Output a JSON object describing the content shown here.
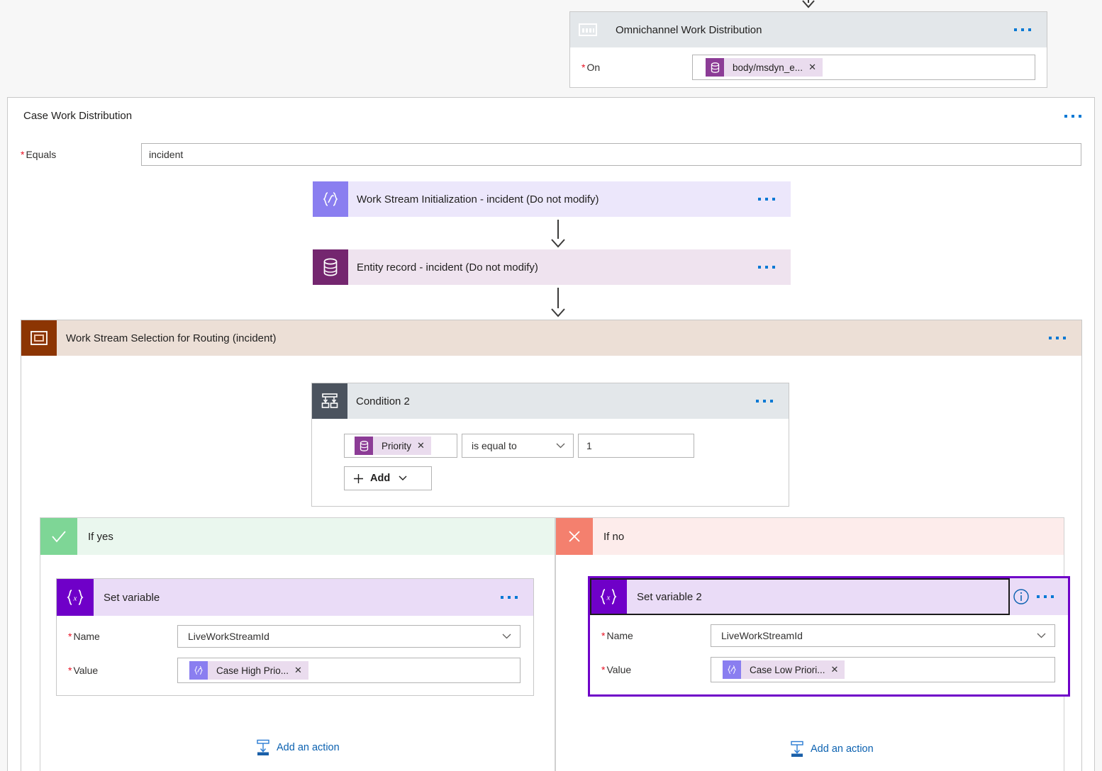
{
  "trigger": {
    "title": "Omnichannel Work Distribution",
    "icon": "keyboard-icon",
    "menu": "more-options",
    "field": {
      "label": "On",
      "required": true,
      "token": "body/msdyn_e...",
      "token_icon": "database-icon"
    }
  },
  "surface": {
    "title": "Case Work Distribution",
    "menu": "more-options",
    "equals": {
      "label": "Equals",
      "required": true,
      "value": "incident"
    }
  },
  "cards": {
    "work_stream_init": {
      "title": "Work Stream Initialization - incident (Do not modify)",
      "icon": "expression-icon"
    },
    "entity_record": {
      "title": "Entity record - incident (Do not modify)",
      "icon": "database-icon"
    }
  },
  "scope": {
    "title": "Work Stream Selection for Routing (incident)",
    "icon": "scope-icon"
  },
  "condition": {
    "title": "Condition 2",
    "icon": "condition-icon",
    "operand_token": "Priority",
    "operand_token_icon": "database-icon",
    "operator": "is equal to",
    "value": "1",
    "add_label": "Add"
  },
  "branches": [
    {
      "key": "yes",
      "label": "If yes",
      "icon": "check-icon",
      "action": {
        "title": "Set variable",
        "icon": "variable-icon",
        "selected": false,
        "has_info": false,
        "name_label": "Name",
        "name_value": "LiveWorkStreamId",
        "value_label": "Value",
        "value_token": "Case High Prio...",
        "value_token_icon": "expression-icon"
      },
      "add_action": "Add an action"
    },
    {
      "key": "no",
      "label": "If no",
      "icon": "cross-icon",
      "action": {
        "title": "Set variable 2",
        "icon": "variable-icon",
        "selected": true,
        "has_info": true,
        "name_label": "Name",
        "name_value": "LiveWorkStreamId",
        "value_label": "Value",
        "value_token": "Case Low Priori...",
        "value_token_icon": "expression-icon"
      },
      "add_action": "Add an action"
    }
  ],
  "colors": {
    "accent_blue": "#0078d4",
    "link_blue": "#0b61b0",
    "required_red": "#e81123",
    "selection_purple": "#6f00c8",
    "trigger_header": "#e3e7ea",
    "lavender_header": "#ece7fb",
    "plum_header": "#efe3ef",
    "sand_header": "#ecdfd6",
    "yes_green": "#7ed696",
    "no_red": "#f4806e"
  }
}
